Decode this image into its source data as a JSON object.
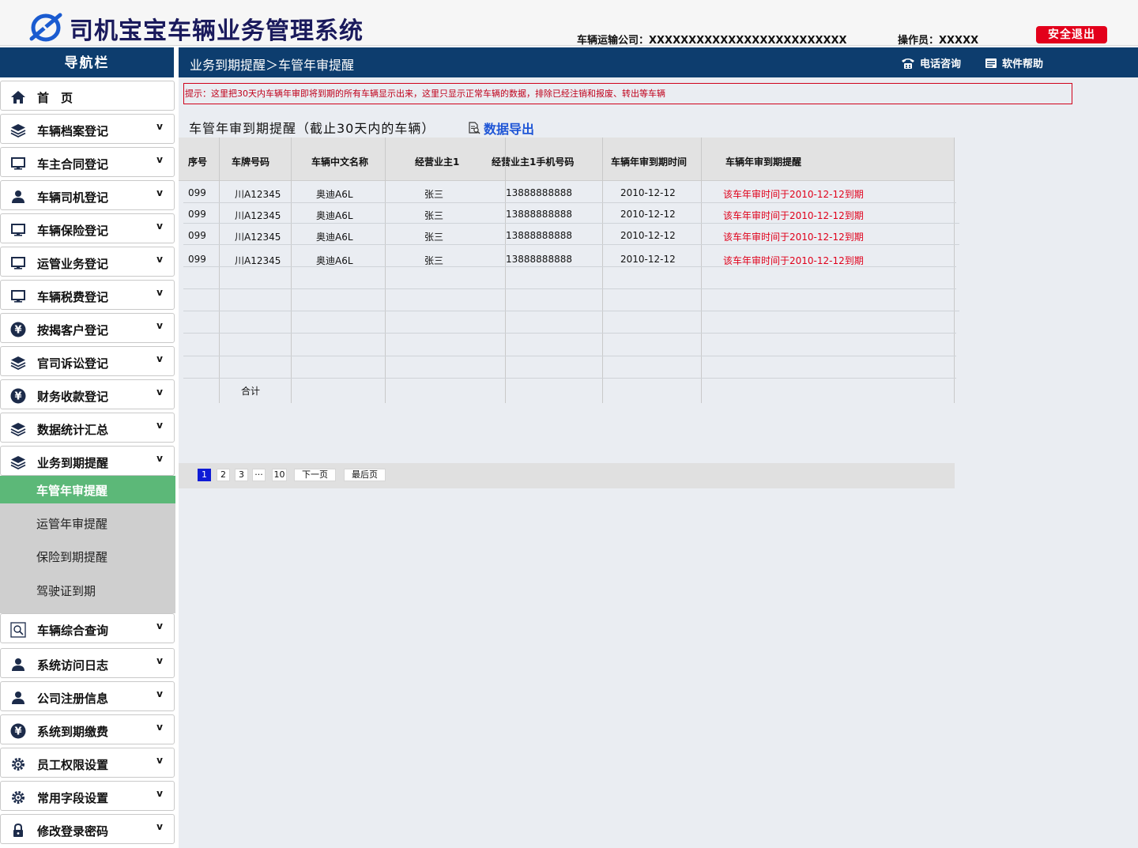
{
  "header": {
    "app_title": "司机宝宝车辆业务管理系统",
    "company": "车辆运输公司：XXXXXXXXXXXXXXXXXXXXXXXXX",
    "operator": "操作员：XXXXX",
    "logout_label": "安全退出"
  },
  "nav": {
    "title": "导航栏"
  },
  "topbar": {
    "breadcrumb": "业务到期提醒＞车管年审提醒",
    "phone_label": "电话咨询",
    "help_label": "软件帮助"
  },
  "sidebar": {
    "items": [
      {
        "label": "首　页",
        "icon": "home-icon",
        "chevron": ""
      },
      {
        "label": "车辆档案登记",
        "icon": "layers-icon",
        "chevron": "v"
      },
      {
        "label": "车主合同登记",
        "icon": "monitor-icon",
        "chevron": "v"
      },
      {
        "label": "车辆司机登记",
        "icon": "user-icon",
        "chevron": "v"
      },
      {
        "label": "车辆保险登记",
        "icon": "monitor-icon",
        "chevron": "v"
      },
      {
        "label": "运管业务登记",
        "icon": "monitor-icon",
        "chevron": "v"
      },
      {
        "label": "车辆税费登记",
        "icon": "monitor-icon",
        "chevron": "v"
      },
      {
        "label": "按揭客户登记",
        "icon": "yen-icon",
        "chevron": "v"
      },
      {
        "label": "官司诉讼登记",
        "icon": "layers-icon",
        "chevron": "v"
      },
      {
        "label": "财务收款登记",
        "icon": "yen-icon",
        "chevron": "v"
      },
      {
        "label": "数据统计汇总",
        "icon": "layers-icon",
        "chevron": "v"
      },
      {
        "label": "业务到期提醒",
        "icon": "layers-icon",
        "chevron": "v"
      }
    ],
    "sub_items": [
      {
        "label": "车管年审提醒",
        "active": true
      },
      {
        "label": "运管年审提醒",
        "active": false
      },
      {
        "label": "保险到期提醒",
        "active": false
      },
      {
        "label": "驾驶证到期",
        "active": false
      }
    ],
    "items_after": [
      {
        "label": "车辆综合查询",
        "icon": "search-icon",
        "chevron": "v"
      },
      {
        "label": "系统访问日志",
        "icon": "user-icon",
        "chevron": "v"
      },
      {
        "label": "公司注册信息",
        "icon": "user-icon",
        "chevron": "v"
      },
      {
        "label": "系统到期缴费",
        "icon": "yen-icon",
        "chevron": "v"
      },
      {
        "label": "员工权限设置",
        "icon": "gear-icon",
        "chevron": "v"
      },
      {
        "label": "常用字段设置",
        "icon": "gear-icon",
        "chevron": "v"
      },
      {
        "label": "修改登录密码",
        "icon": "lock-icon",
        "chevron": "v"
      }
    ]
  },
  "content": {
    "hint": "提示：这里把30天内车辆年审即将到期的所有车辆显示出来，这里只显示正常车辆的数据，排除已经注销和报废、转出等车辆",
    "section_title": "车管年审到期提醒（截止30天内的车辆）",
    "export_label": "数据导出",
    "table": {
      "columns": [
        "序号",
        "车牌号码",
        "车辆中文名称",
        "经营业主1",
        "经营业主1手机号码",
        "车辆年审到期时间",
        "车辆年审到期提醒"
      ],
      "rows": [
        [
          "099",
          "川A12345",
          "奥迪A6L",
          "张三",
          "13888888888",
          "2010-12-12",
          "该车年审时间于2010-12-12到期"
        ],
        [
          "099",
          "川A12345",
          "奥迪A6L",
          "张三",
          "13888888888",
          "2010-12-12",
          "该车年审时间于2010-12-12到期"
        ],
        [
          "099",
          "川A12345",
          "奥迪A6L",
          "张三",
          "13888888888",
          "2010-12-12",
          "该车年审时间于2010-12-12到期"
        ],
        [
          "099",
          "川A12345",
          "奥迪A6L",
          "张三",
          "13888888888",
          "2010-12-12",
          "该车年审时间于2010-12-12到期"
        ]
      ],
      "total_label": "合计"
    },
    "pager": {
      "pages": [
        "1",
        "2",
        "3",
        "···",
        "10"
      ],
      "current": "1",
      "next_label": "下一页",
      "last_label": "最后页"
    }
  },
  "colors": {
    "navy": "#0d3d6e",
    "active_green": "#5cb878",
    "logout_red": "#e3001b",
    "hint_red": "#c0001a",
    "link_blue": "#1e55d6"
  }
}
